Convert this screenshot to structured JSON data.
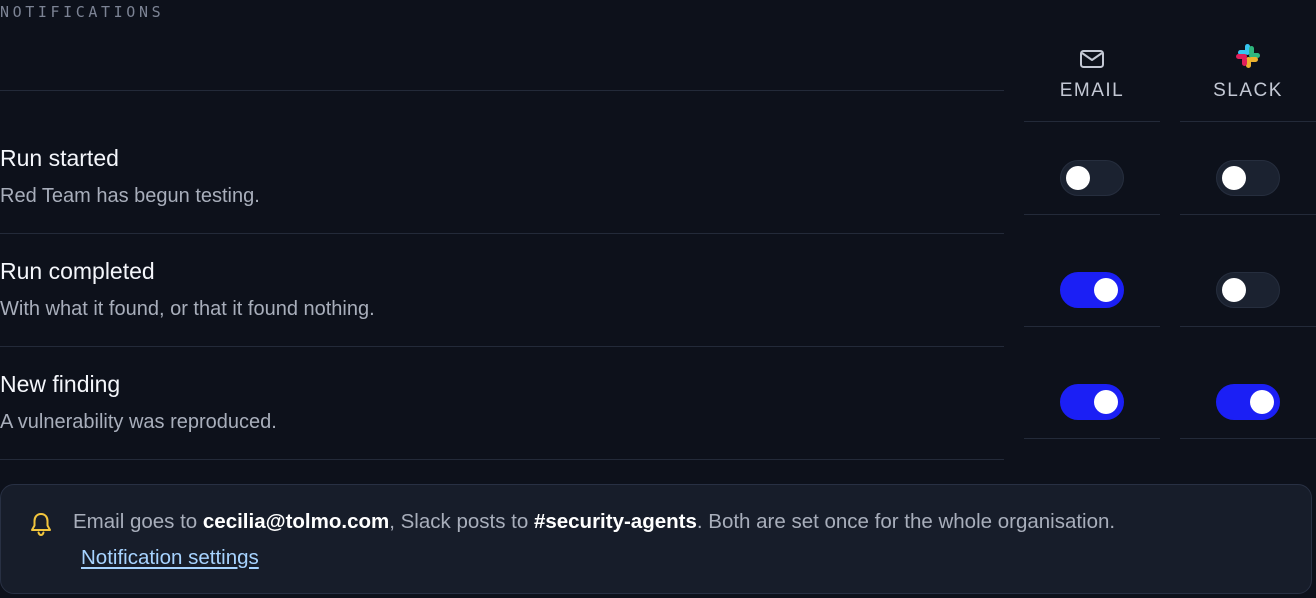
{
  "section": {
    "label": "NOTIFICATIONS"
  },
  "columns": [
    {
      "label": "EMAIL",
      "icon": "mail-icon"
    },
    {
      "label": "SLACK",
      "icon": "slack-icon"
    }
  ],
  "rows": [
    {
      "title": "Run started",
      "description": "Red Team has begun testing.",
      "email": false,
      "slack": false
    },
    {
      "title": "Run completed",
      "description": "With what it found, or that it found nothing.",
      "email": true,
      "slack": false
    },
    {
      "title": "New finding",
      "description": "A vulnerability was reproduced.",
      "email": true,
      "slack": true
    }
  ],
  "info": {
    "icon": "bell-icon",
    "prefix": "Email goes to ",
    "email": "cecilia@tolmo.com",
    "middle": ", Slack posts to ",
    "channel": "#security-agents",
    "suffix": ". Both are set once for the whole organisation.",
    "link_label": "Notification settings"
  },
  "colors": {
    "background": "#0d111b",
    "toggle_on": "#1b1ff5",
    "toggle_off": "#1b2230",
    "link": "#a7d3ff",
    "bell": "#f2c53d"
  }
}
